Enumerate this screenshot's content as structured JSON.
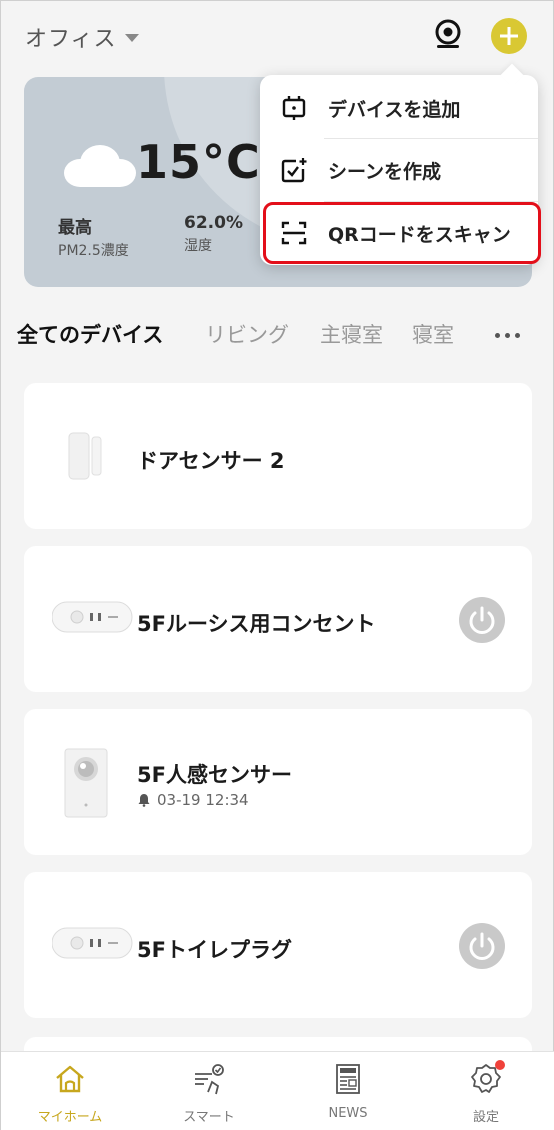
{
  "header": {
    "home_name": "オフィス"
  },
  "weather": {
    "temperature": "15°C",
    "stats": [
      {
        "value": "最高",
        "label": "PM2.5濃度"
      },
      {
        "value": "62.0%",
        "label": "湿度"
      }
    ]
  },
  "menu": {
    "items": [
      {
        "label": "デバイスを追加",
        "icon": "device-add-icon"
      },
      {
        "label": "シーンを作成",
        "icon": "scene-create-icon"
      },
      {
        "label": "QRコードをスキャン",
        "icon": "qr-scan-icon"
      }
    ]
  },
  "tabs": [
    "全てのデバイス",
    "リビング",
    "主寝室",
    "寝室"
  ],
  "devices": [
    {
      "name": "ドアセンサー 2",
      "icon": "door-sensor-icon"
    },
    {
      "name": "5Fルーシス用コンセント",
      "icon": "smart-plug-icon",
      "power": true
    },
    {
      "name": "5F人感センサー",
      "icon": "motion-sensor-icon",
      "sub": "03-19 12:34"
    },
    {
      "name": "5Fトイレプラグ",
      "icon": "smart-plug-icon",
      "power": true
    }
  ],
  "bottom_nav": [
    {
      "label": "マイホーム",
      "icon": "home-icon",
      "active": true
    },
    {
      "label": "スマート",
      "icon": "smart-icon"
    },
    {
      "label": "NEWS",
      "icon": "news-icon"
    },
    {
      "label": "設定",
      "icon": "settings-icon",
      "badge": true
    }
  ],
  "colors": {
    "accent": "#d9c833",
    "nav_active": "#c7a71e",
    "highlight_border": "#e30f1a",
    "weather_bg": "#c3ccd4",
    "badge": "#f0413a"
  }
}
